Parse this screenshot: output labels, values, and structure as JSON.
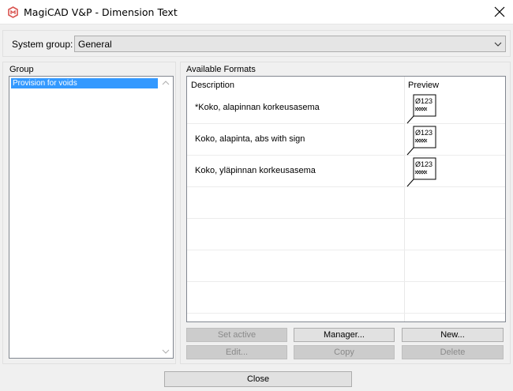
{
  "window": {
    "title": "MagiCAD V&P - Dimension Text"
  },
  "system_group": {
    "label": "System group:",
    "selected": "General"
  },
  "group": {
    "label": "Group",
    "items": [
      "Provision for voids"
    ]
  },
  "formats": {
    "label": "Available Formats",
    "columns": [
      "Description",
      "Preview"
    ],
    "rows": [
      {
        "description": "*Koko, alapinnan korkeusasema",
        "preview_text": "Ø123"
      },
      {
        "description": "Koko, alapinta, abs with sign",
        "preview_text": "Ø123"
      },
      {
        "description": "Koko, yläpinnan korkeusasema",
        "preview_text": "Ø123"
      }
    ]
  },
  "buttons": {
    "set_active": "Set active",
    "manager": "Manager...",
    "new": "New...",
    "edit": "Edit...",
    "copy": "Copy",
    "delete": "Delete",
    "close": "Close"
  },
  "colors": {
    "selection": "#3399ff",
    "app_icon": "#d9534f"
  }
}
